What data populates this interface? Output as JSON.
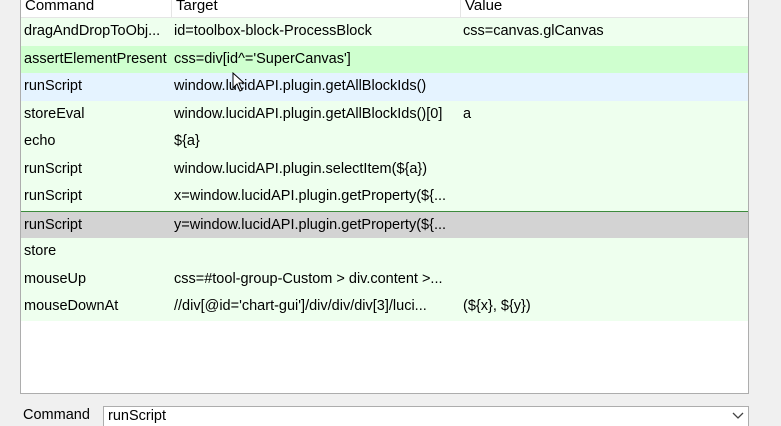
{
  "columns": {
    "command": "Command",
    "target": "Target",
    "value": "Value"
  },
  "rows": [
    {
      "command": "dragAndDropToObj...",
      "target": "id=toolbox-block-ProcessBlock",
      "value": "css=canvas.glCanvas"
    },
    {
      "command": "assertElementPresent",
      "target": "css=div[id^='SuperCanvas']",
      "value": ""
    },
    {
      "command": "runScript",
      "target": "window.lucidAPI.plugin.getAllBlockIds()",
      "value": ""
    },
    {
      "command": "storeEval",
      "target": "window.lucidAPI.plugin.getAllBlockIds()[0]",
      "value": "a"
    },
    {
      "command": "echo",
      "target": "${a}",
      "value": ""
    },
    {
      "command": "runScript",
      "target": "window.lucidAPI.plugin.selectItem(${a})",
      "value": ""
    },
    {
      "command": "runScript",
      "target": "x=window.lucidAPI.plugin.getProperty(${...",
      "value": ""
    },
    {
      "command": "runScript",
      "target": "y=window.lucidAPI.plugin.getProperty(${...",
      "value": ""
    },
    {
      "command": "store",
      "target": "",
      "value": ""
    },
    {
      "command": "mouseUp",
      "target": "css=#tool-group-Custom > div.content >...",
      "value": ""
    },
    {
      "command": "mouseDownAt",
      "target": "//div[@id='chart-gui']/div/div/div[3]/luci...",
      "value": "(${x}, ${y})"
    }
  ],
  "editor": {
    "command_label": "Command",
    "command_value": "runScript"
  }
}
